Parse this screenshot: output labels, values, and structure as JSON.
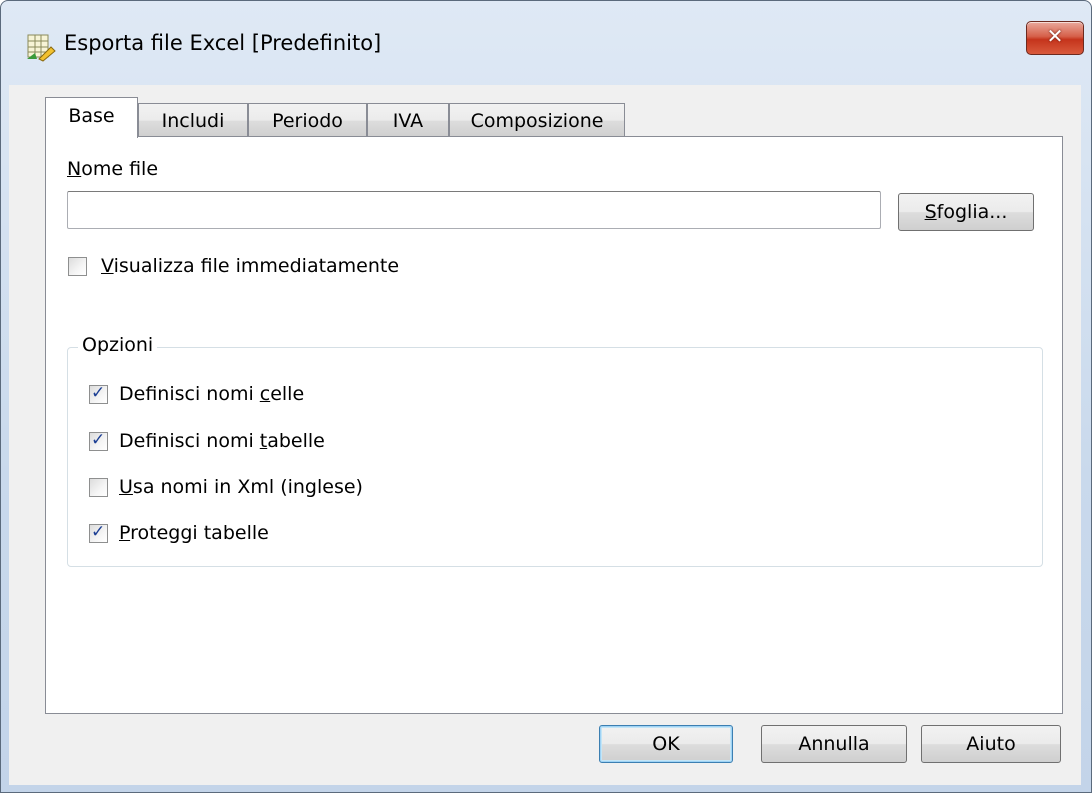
{
  "window": {
    "title": "Esporta file Excel [Predefinito]",
    "close_symbol": "✕"
  },
  "tabs": [
    {
      "label": "Base",
      "active": true
    },
    {
      "label": "Includi",
      "active": false
    },
    {
      "label": "Periodo",
      "active": false
    },
    {
      "label": "IVA",
      "active": false
    },
    {
      "label": "Composizione",
      "active": false
    }
  ],
  "base": {
    "filename_label_mn": "N",
    "filename_label_rest": "ome file",
    "filename_value": "",
    "browse_button_mn": "S",
    "browse_button_rest": "foglia...",
    "view_now": {
      "mn": "V",
      "rest": "isualizza file immediatamente",
      "checked": false
    },
    "options_group_title": "Opzioni",
    "options": [
      {
        "pre": "Definisci nomi ",
        "mn": "c",
        "post": "elle",
        "checked": true
      },
      {
        "pre": "Definisci nomi ",
        "mn": "t",
        "post": "abelle",
        "checked": true
      },
      {
        "pre": "",
        "mn": "U",
        "post": "sa nomi in Xml (inglese)",
        "checked": false
      },
      {
        "pre": "",
        "mn": "P",
        "post": "roteggi tabelle",
        "checked": true
      }
    ]
  },
  "footer": {
    "ok_label": "OK",
    "cancel_label": "Annulla",
    "help_label": "Aiuto"
  },
  "check_symbol": "✓",
  "colors": {
    "titlebar_top": "#dfe9f5",
    "close_red": "#c5341c",
    "check_blue": "#1c3f94",
    "dialog_bg": "#f0f0f0"
  }
}
